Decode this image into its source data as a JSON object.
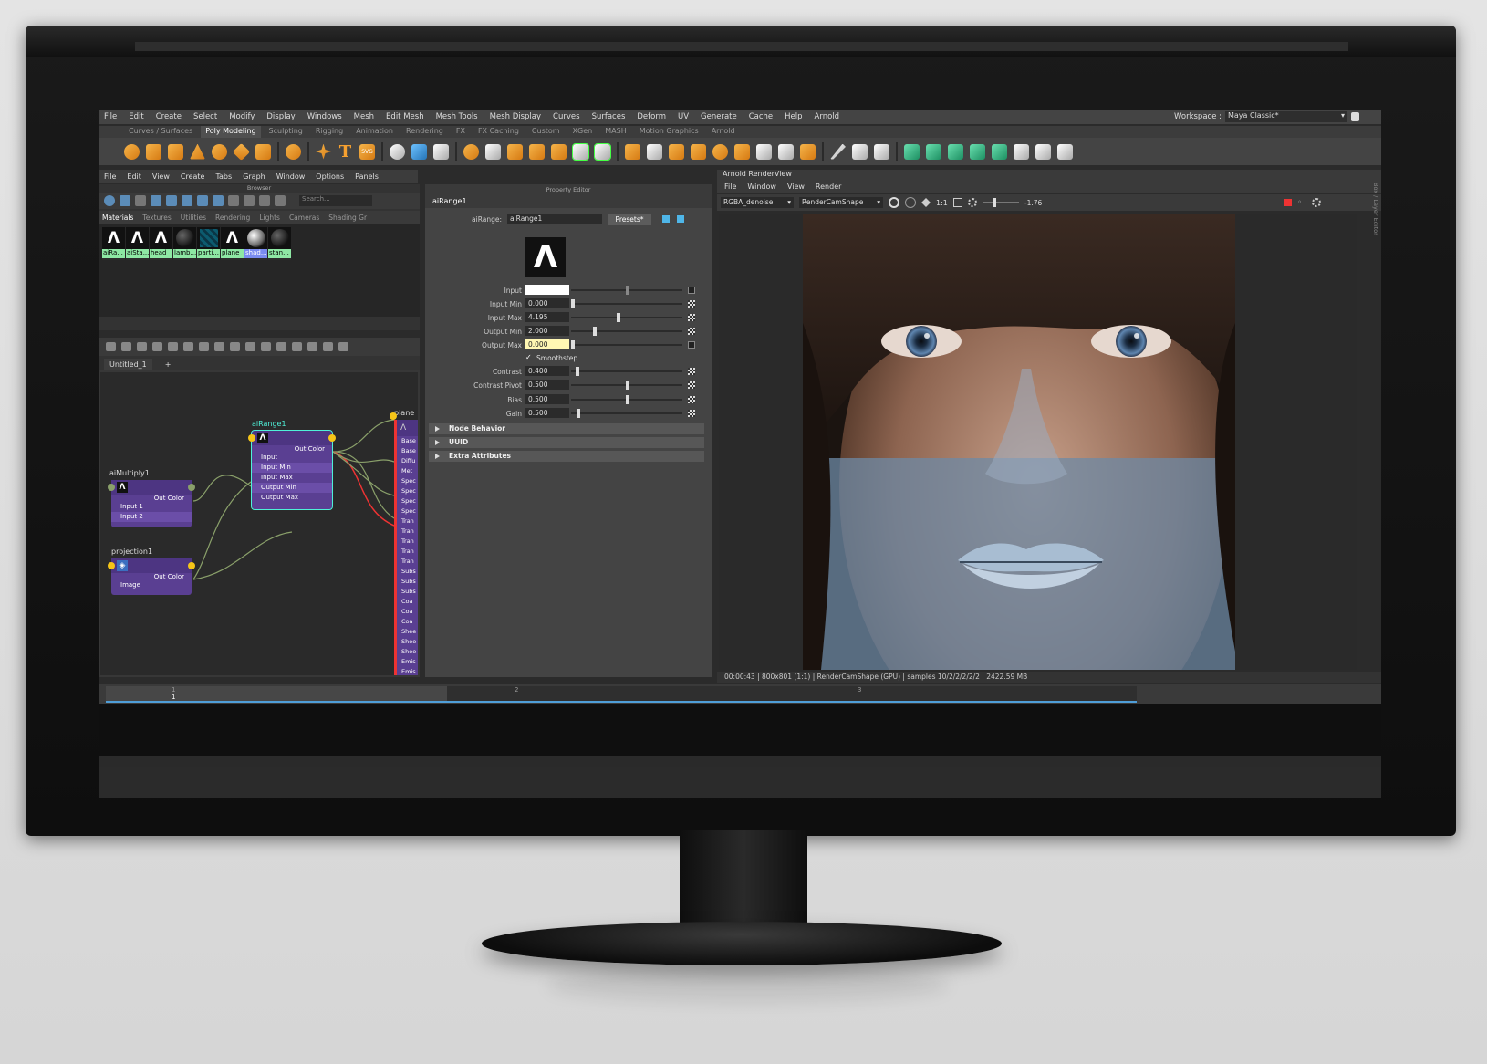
{
  "menu": [
    "File",
    "Edit",
    "Create",
    "Select",
    "Modify",
    "Display",
    "Windows",
    "Mesh",
    "Edit Mesh",
    "Mesh Tools",
    "Mesh Display",
    "Curves",
    "Surfaces",
    "Deform",
    "UV",
    "Generate",
    "Cache",
    "Help",
    "Arnold"
  ],
  "workspace": {
    "label": "Workspace :",
    "value": "Maya Classic*"
  },
  "shelf_tabs": [
    "Curves / Surfaces",
    "Poly Modeling",
    "Sculpting",
    "Rigging",
    "Animation",
    "Rendering",
    "FX",
    "FX Caching",
    "Custom",
    "XGen",
    "MASH",
    "Motion Graphics",
    "Arnold"
  ],
  "shelf_active": "Poly Modeling",
  "hypershade": {
    "menu": [
      "File",
      "Edit",
      "View",
      "Create",
      "Tabs",
      "Graph",
      "Window",
      "Options",
      "Panels"
    ],
    "browser_title": "Browser",
    "search_placeholder": "Search...",
    "tabs": [
      "Materials",
      "Textures",
      "Utilities",
      "Rendering",
      "Lights",
      "Cameras",
      "Shading Gr"
    ],
    "swatches": [
      "aiRa...",
      "aiSta...",
      "head",
      "lamb...",
      "parti...",
      "plane",
      "shad...",
      "stan..."
    ],
    "graph_tab": "Untitled_1",
    "graph_tab_add": "+"
  },
  "nodes": {
    "airange": {
      "name": "aiRange1",
      "out": "Out Color",
      "ports": [
        "Input",
        "Input Min",
        "Input Max",
        "Output Min",
        "Output Max"
      ]
    },
    "aimultiply": {
      "name": "aiMultiply1",
      "out": "Out Color",
      "ports": [
        "Input 1",
        "Input 2"
      ]
    },
    "projection": {
      "name": "projection1",
      "out": "Out Color",
      "ports": [
        "Image"
      ]
    },
    "plane": {
      "name": "plane",
      "ports": [
        "Base",
        "Base",
        "Diffu",
        "Met",
        "Spec",
        "Spec",
        "Spec",
        "Spec",
        "Tran",
        "Tran",
        "Tran",
        "Tran",
        "Tran",
        "Subs",
        "Subs",
        "Subs",
        "Coa",
        "Coa",
        "Coa",
        "Shee",
        "Shee",
        "Shee",
        "Emis",
        "Emis"
      ]
    }
  },
  "property_editor": {
    "title": "Property Editor",
    "tab": "aiRange1",
    "type_label": "aiRange:",
    "node_name": "aiRange1",
    "presets": "Presets*",
    "fields": [
      {
        "label": "Input",
        "value": "",
        "slider": 0.5,
        "swatch": true
      },
      {
        "label": "Input Min",
        "value": "0.000",
        "slider": 0.0
      },
      {
        "label": "Input Max",
        "value": "4.195",
        "slider": 0.42
      },
      {
        "label": "Output Min",
        "value": "2.000",
        "slider": 0.2
      },
      {
        "label": "Output Max",
        "value": "0.000",
        "slider": 0.0,
        "highlight": true
      },
      {
        "label": "Contrast",
        "value": "0.400",
        "slider": 0.04
      },
      {
        "label": "Contrast Pivot",
        "value": "0.500",
        "slider": 0.5
      },
      {
        "label": "Bias",
        "value": "0.500",
        "slider": 0.5
      },
      {
        "label": "Gain",
        "value": "0.500",
        "slider": 0.05
      }
    ],
    "smoothstep": "Smoothstep",
    "sections": [
      "Node Behavior",
      "UUID",
      "Extra Attributes"
    ]
  },
  "renderview": {
    "title": "Arnold RenderView",
    "menu": [
      "File",
      "Window",
      "View",
      "Render"
    ],
    "aov": "RGBA_denoise",
    "camera": "RenderCamShape",
    "ratio": "1:1",
    "exposure": "-1.76",
    "status": "00:00:43 | 800x801 (1:1) | RenderCamShape  (GPU) | samples 10/2/2/2/2/2 | 2422.59 MB"
  },
  "timeline": {
    "ticks": [
      "1",
      "2",
      "3"
    ],
    "current": "1"
  },
  "side_tab": "Box / Layer Editor"
}
